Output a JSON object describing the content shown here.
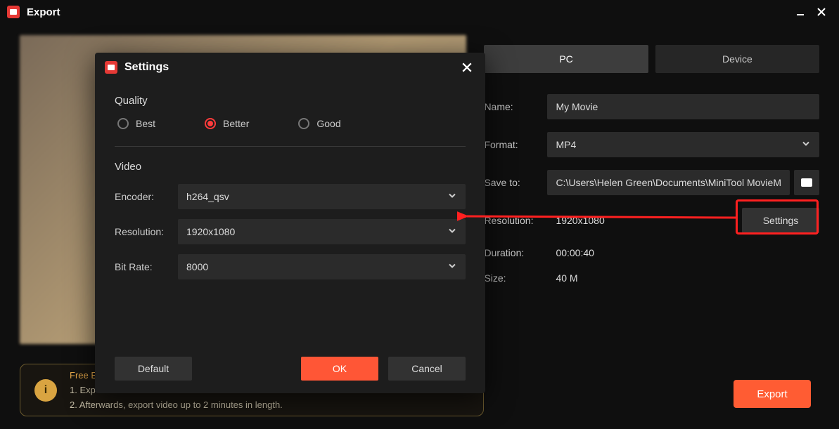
{
  "window": {
    "title": "Export"
  },
  "tabs": {
    "pc": "PC",
    "device": "Device"
  },
  "fields": {
    "name_label": "Name:",
    "name_value": "My Movie",
    "format_label": "Format:",
    "format_value": "MP4",
    "saveto_label": "Save to:",
    "saveto_value": "C:\\Users\\Helen Green\\Documents\\MiniTool MovieM",
    "resolution_label": "Resolution:",
    "resolution_value": "1920x1080",
    "settings_btn": "Settings",
    "duration_label": "Duration:",
    "duration_value": "00:00:40",
    "size_label": "Size:",
    "size_value": "40 M"
  },
  "notice": {
    "top": "Free E",
    "line1": "1. Exp",
    "line2": "2. Afterwards, export video up to 2 minutes in length."
  },
  "export_btn": "Export",
  "modal": {
    "title": "Settings",
    "quality_label": "Quality",
    "quality": {
      "best": "Best",
      "better": "Better",
      "good": "Good"
    },
    "video_label": "Video",
    "encoder_label": "Encoder:",
    "encoder_value": "h264_qsv",
    "resolution_label": "Resolution:",
    "resolution_value": "1920x1080",
    "bitrate_label": "Bit Rate:",
    "bitrate_value": "8000",
    "default_btn": "Default",
    "ok_btn": "OK",
    "cancel_btn": "Cancel"
  }
}
